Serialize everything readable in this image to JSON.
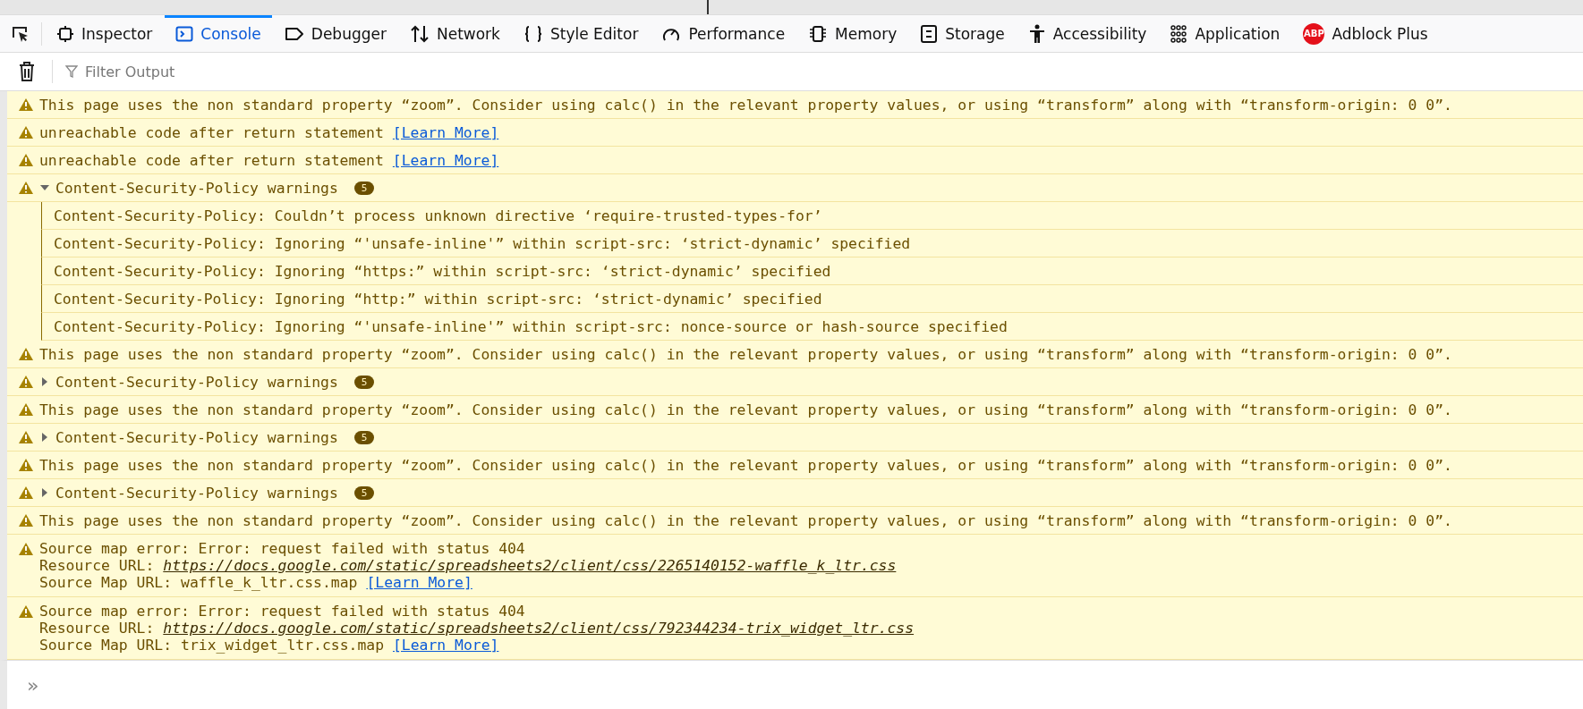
{
  "toolbar": {
    "tabs": [
      {
        "label": "Inspector",
        "selected": false
      },
      {
        "label": "Console",
        "selected": true
      },
      {
        "label": "Debugger",
        "selected": false
      },
      {
        "label": "Network",
        "selected": false
      },
      {
        "label": "Style Editor",
        "selected": false
      },
      {
        "label": "Performance",
        "selected": false
      },
      {
        "label": "Memory",
        "selected": false
      },
      {
        "label": "Storage",
        "selected": false
      },
      {
        "label": "Accessibility",
        "selected": false
      },
      {
        "label": "Application",
        "selected": false
      },
      {
        "label": "Adblock Plus",
        "icon_text": "ABP",
        "selected": false
      }
    ]
  },
  "filter": {
    "placeholder": "Filter Output"
  },
  "messages": [
    {
      "kind": "warning",
      "text": "This page uses the non standard property “zoom”. Consider using calc() in the relevant property values, or using “transform” along with “transform-origin: 0 0”."
    },
    {
      "kind": "warning",
      "text": "unreachable code after return statement",
      "link": "[Learn More]"
    },
    {
      "kind": "warning",
      "text": "unreachable code after return statement",
      "link": "[Learn More]"
    },
    {
      "kind": "group",
      "text": "Content-Security-Policy warnings",
      "count": "5",
      "expanded": true,
      "children": [
        {
          "text": "Content-Security-Policy: Couldn’t process unknown directive ‘require-trusted-types-for’"
        },
        {
          "text": "Content-Security-Policy: Ignoring “'unsafe-inline'” within script-src: ‘strict-dynamic’ specified"
        },
        {
          "text": "Content-Security-Policy: Ignoring “https:” within script-src: ‘strict-dynamic’ specified"
        },
        {
          "text": "Content-Security-Policy: Ignoring “http:” within script-src: ‘strict-dynamic’ specified"
        },
        {
          "text": "Content-Security-Policy: Ignoring “'unsafe-inline'” within script-src: nonce-source or hash-source specified"
        }
      ]
    },
    {
      "kind": "warning",
      "text": "This page uses the non standard property “zoom”. Consider using calc() in the relevant property values, or using “transform” along with “transform-origin: 0 0”."
    },
    {
      "kind": "group",
      "text": "Content-Security-Policy warnings",
      "count": "5",
      "expanded": false
    },
    {
      "kind": "warning",
      "text": "This page uses the non standard property “zoom”. Consider using calc() in the relevant property values, or using “transform” along with “transform-origin: 0 0”."
    },
    {
      "kind": "group",
      "text": "Content-Security-Policy warnings",
      "count": "5",
      "expanded": false
    },
    {
      "kind": "warning",
      "text": "This page uses the non standard property “zoom”. Consider using calc() in the relevant property values, or using “transform” along with “transform-origin: 0 0”."
    },
    {
      "kind": "group",
      "text": "Content-Security-Policy warnings",
      "count": "5",
      "expanded": false
    },
    {
      "kind": "warning",
      "text": "This page uses the non standard property “zoom”. Consider using calc() in the relevant property values, or using “transform” along with “transform-origin: 0 0”."
    },
    {
      "kind": "sourcemap",
      "text": "Source map error: Error: request failed with status 404",
      "resource_label": "Resource URL:",
      "resource_url": "https://docs.google.com/static/spreadsheets2/client/css/2265140152-waffle_k_ltr.css",
      "map_label": "Source Map URL:",
      "map_url": "waffle_k_ltr.css.map",
      "link": "[Learn More]"
    },
    {
      "kind": "sourcemap",
      "text": "Source map error: Error: request failed with status 404",
      "resource_label": "Resource URL:",
      "resource_url": "https://docs.google.com/static/spreadsheets2/client/css/792344234-trix_widget_ltr.css",
      "map_label": "Source Map URL:",
      "map_url": "trix_widget_ltr.css.map",
      "link": "[Learn More]"
    }
  ],
  "prompt": {
    "symbol": "»"
  }
}
